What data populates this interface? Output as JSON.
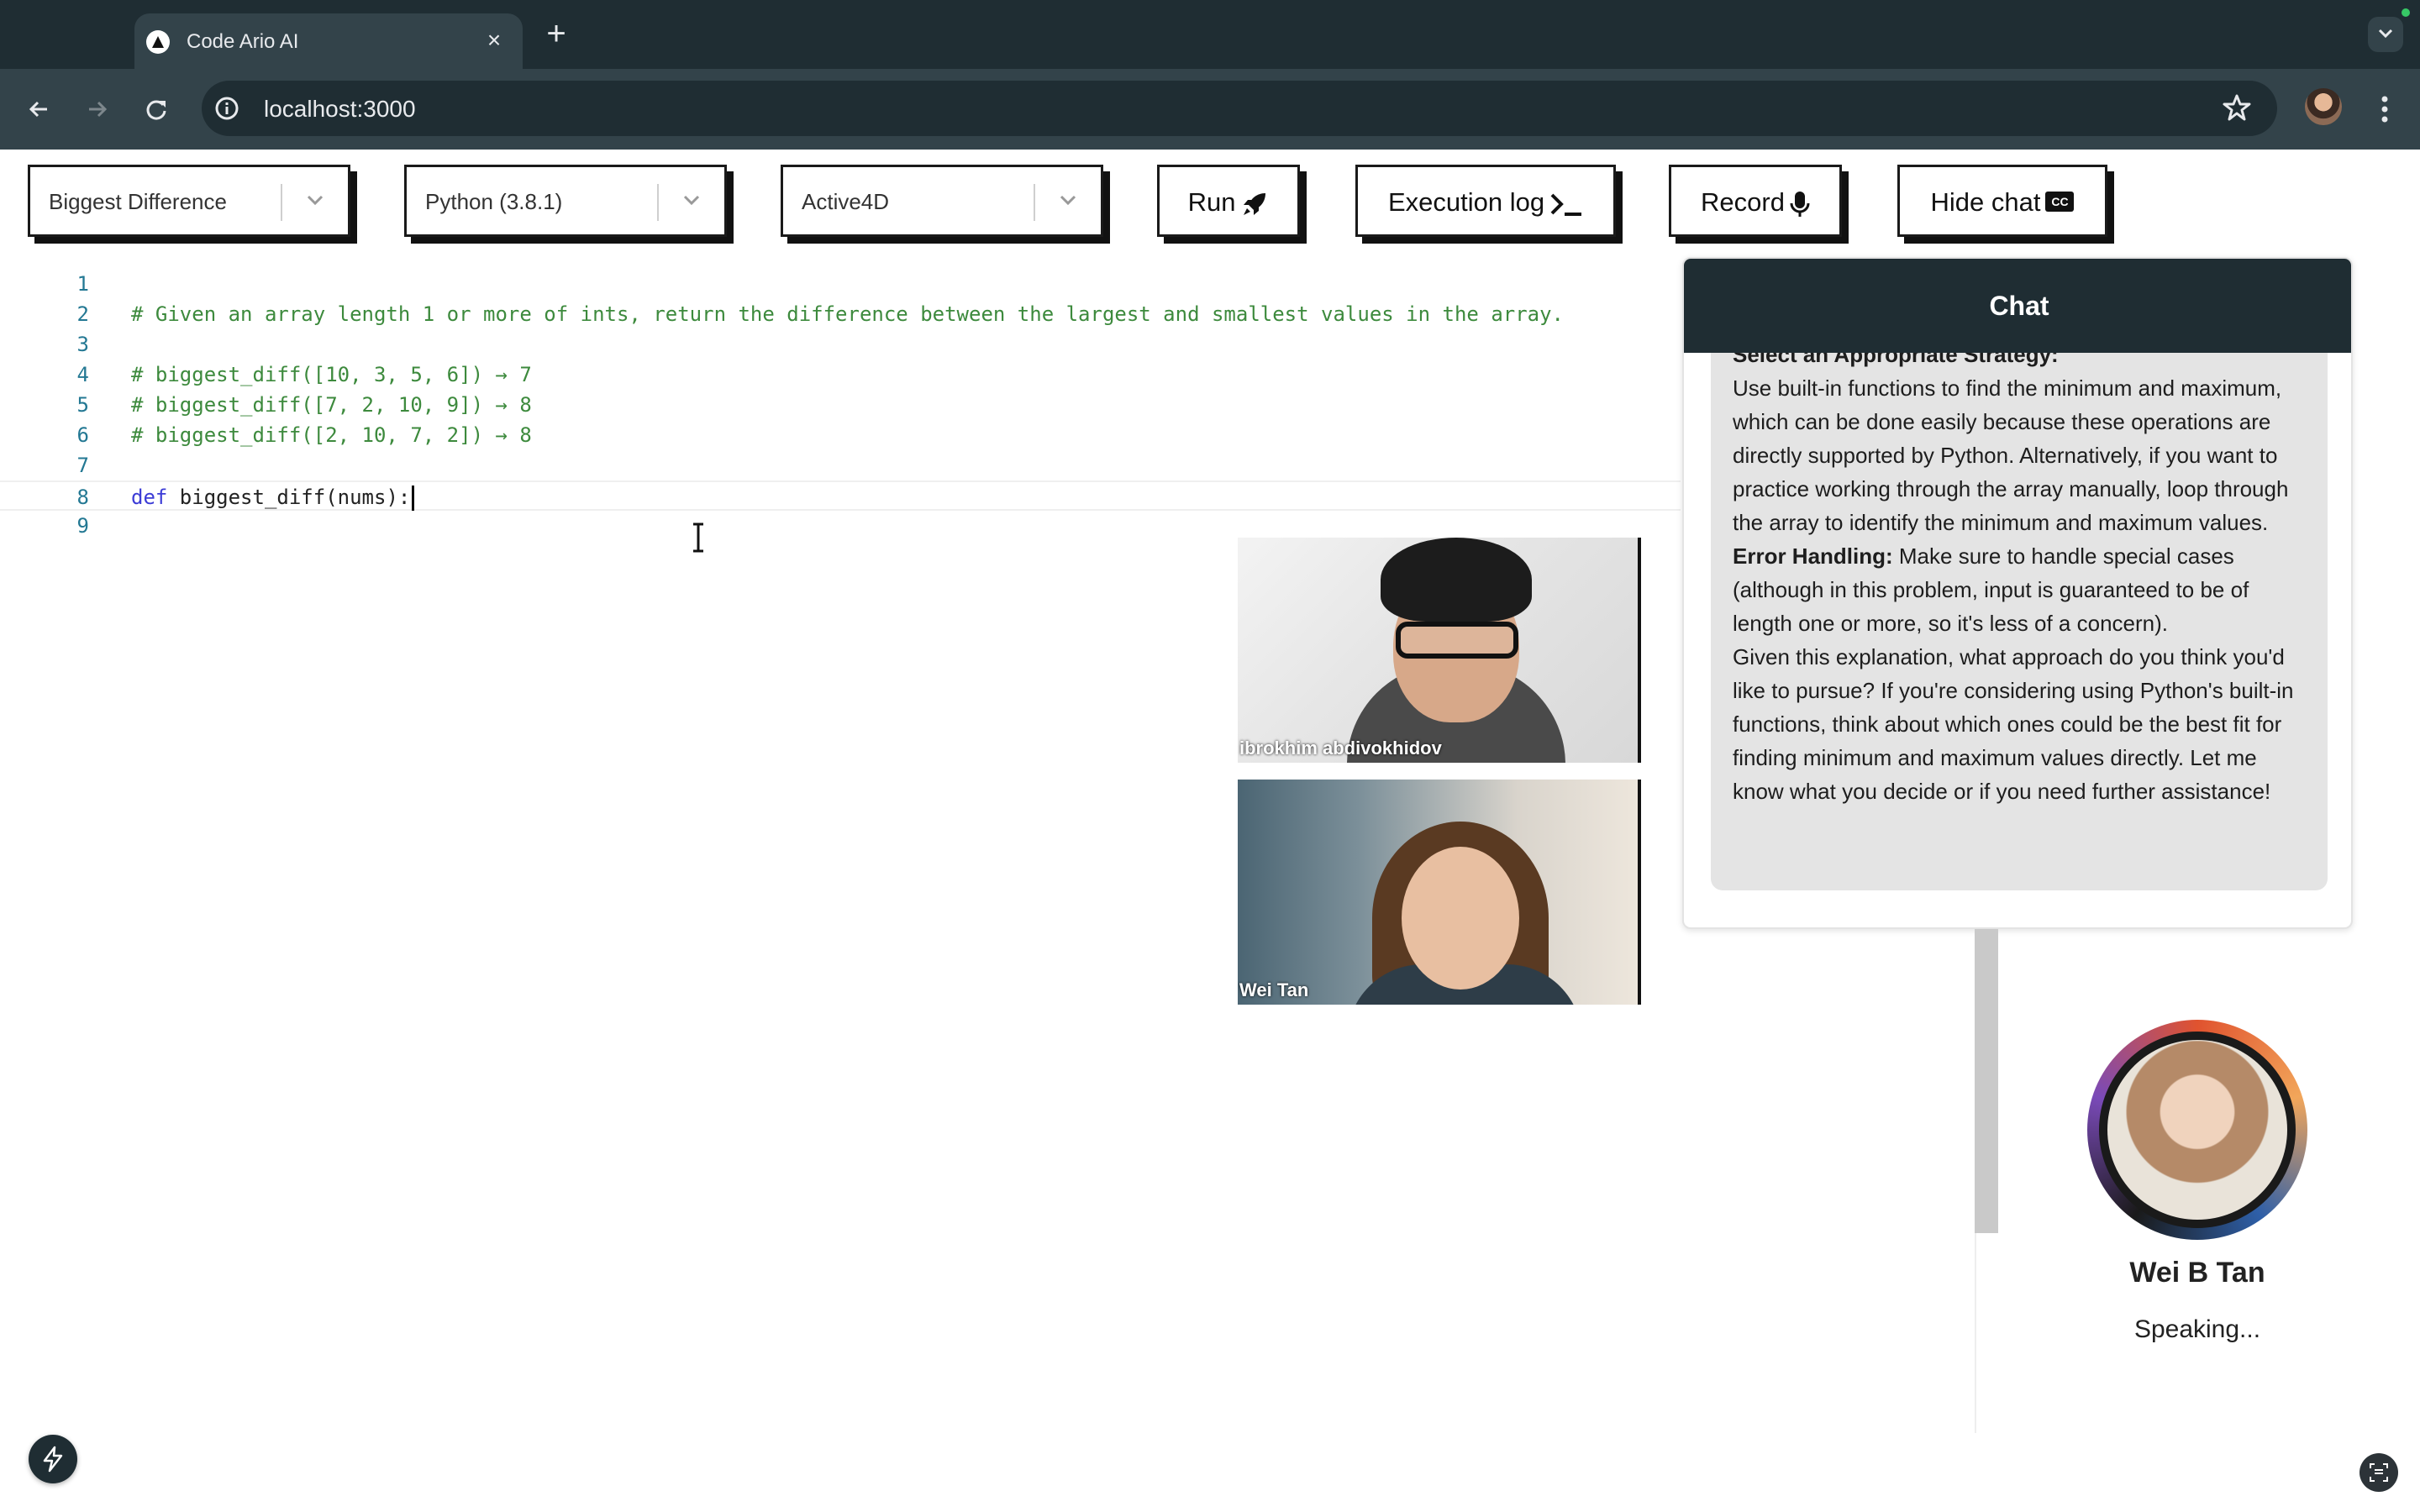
{
  "browser": {
    "tab_title": "Code Ario AI",
    "url": "localhost:3000"
  },
  "controls": {
    "problem_select": "Biggest Difference",
    "language_select": "Python (3.8.1)",
    "theme_select": "Active4D",
    "run_label": "Run",
    "execution_log_label": "Execution log",
    "record_label": "Record",
    "hide_chat_label": "Hide chat",
    "cc_badge": "CC"
  },
  "editor": {
    "lines": [
      {
        "num": "1",
        "text": ""
      },
      {
        "num": "2",
        "text": "# Given an array length 1 or more of ints, return the difference between the largest and smallest values in the array."
      },
      {
        "num": "3",
        "text": ""
      },
      {
        "num": "4",
        "text": "# biggest_diff([10, 3, 5, 6]) → 7"
      },
      {
        "num": "5",
        "text": "# biggest_diff([7, 2, 10, 9]) → 8"
      },
      {
        "num": "6",
        "text": "# biggest_diff([2, 10, 7, 2]) → 8"
      },
      {
        "num": "7",
        "text": ""
      },
      {
        "num": "8",
        "keyword": "def",
        "text": " biggest_diff(nums):"
      },
      {
        "num": "9",
        "text": ""
      }
    ]
  },
  "videos": [
    {
      "name": "ibrokhim abdivokhidov"
    },
    {
      "name": "Wei Tan"
    }
  ],
  "chat": {
    "title": "Chat",
    "message": {
      "heading_cut": "Select an Appropriate Strategy:",
      "p1": "Use built-in functions to find the minimum and maximum, which can be done easily because these operations are directly supported by Python. Alternatively, if you want to practice working through the array manually, loop through the array to identify the minimum and maximum values.",
      "error_label": "Error Handling:",
      "p2": " Make sure to handle special cases (although in this problem, input is guaranteed to be of length one or more, so it's less of a concern).",
      "p3": "Given this explanation, what approach do you think you'd like to pursue? If you're considering using Python's built-in functions, think about which ones could be the best fit for finding minimum and maximum values directly. Let me know what you decide or if you need further assistance!"
    }
  },
  "speaker": {
    "name": "Wei B Tan",
    "status": "Speaking..."
  }
}
